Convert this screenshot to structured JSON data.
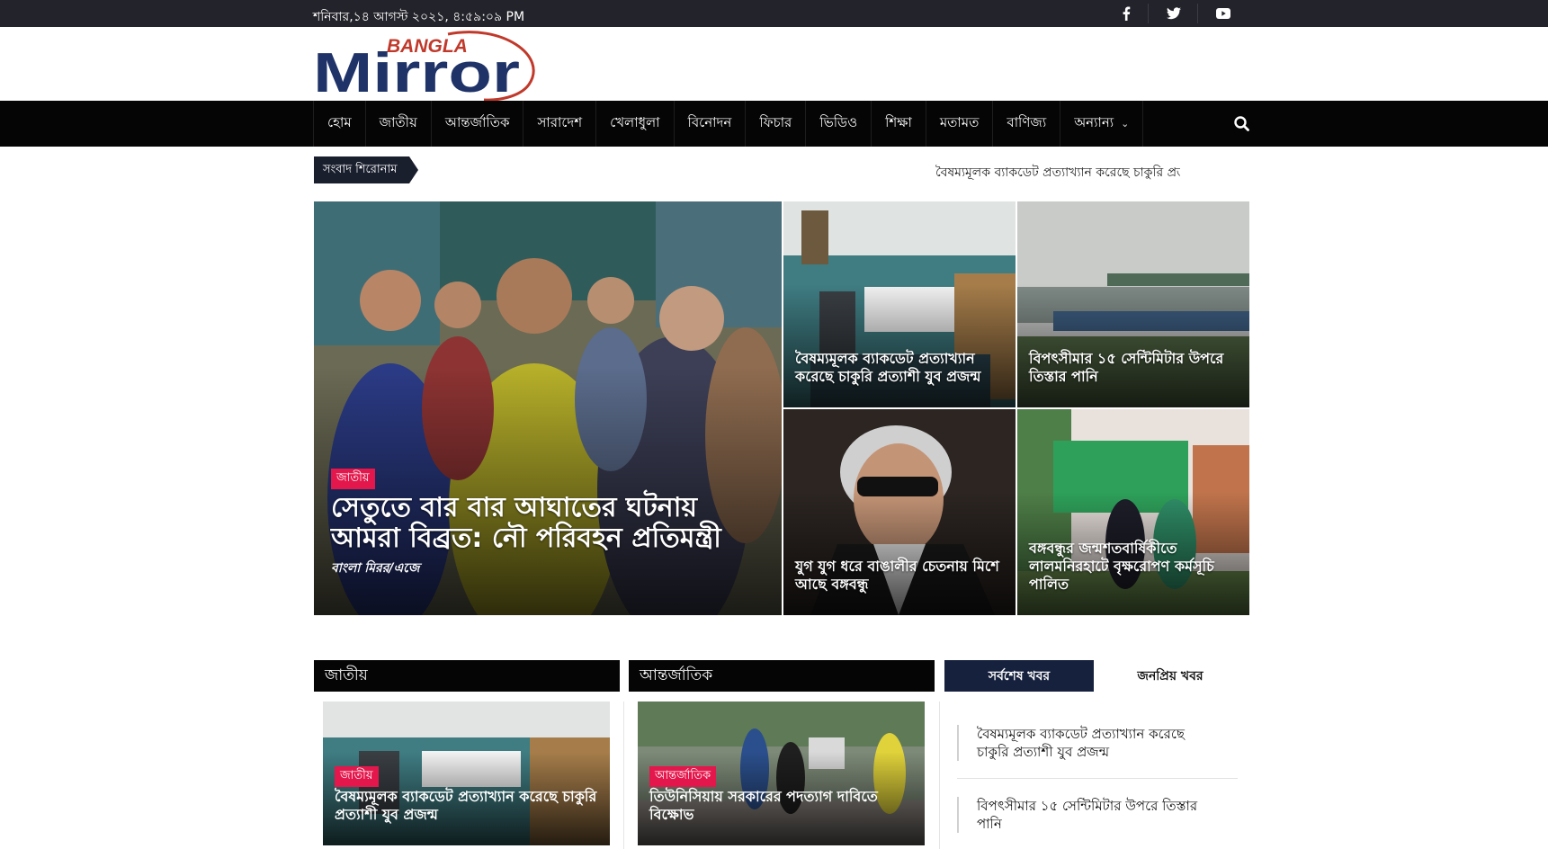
{
  "topbar": {
    "datetime": "শনিবার,১৪ আগস্ট ২০২১, ৪:৫৯:০৯ PM",
    "social_icons": [
      "facebook-icon",
      "twitter-icon",
      "youtube-icon"
    ]
  },
  "logo": {
    "small_text": "BANGLA",
    "big_text": "Mirror"
  },
  "nav": {
    "items": [
      "হোম",
      "জাতীয়",
      "আন্তর্জাতিক",
      "সারাদেশ",
      "খেলাধুলা",
      "বিনোদন",
      "ফিচার",
      "ভিডিও",
      "শিক্ষা",
      "মতামত",
      "বাণিজ্য",
      "অন্যান্য"
    ],
    "search_icon": "search-icon"
  },
  "ticker": {
    "label": "সংবাদ শিরোনাম",
    "text": "বৈষম্যমূলক ব্যাকডেট প্রত্যাখ্যান করেছে চাকুরি প্রত্যাশী যুব প্রজন্ম"
  },
  "feature": {
    "main": {
      "category": "জাতীয়",
      "title": "সেতুতে বার বার আঘাতের ঘটনায় আমরা বিব্রত: নৌ পরিবহন প্রতিমন্ত্রী",
      "byline": "বাংলা মিরর/এজে"
    },
    "tiles": [
      {
        "title": "বৈষম্যমূলক ব্যাকডেট প্রত্যাখ্যান করেছে চাকুরি প্রত্যাশী যুব প্রজন্ম"
      },
      {
        "title": "বিপৎসীমার ১৫ সেন্টিমিটার উপরে তিস্তার পানি"
      },
      {
        "title": "যুগ যুগ ধরে বাঙালীর চেতনায় মিশে আছে বঙ্গবন্ধু"
      },
      {
        "title": "বঙ্গবন্ধুর জন্মশতবার্ষিকীতে লালমনিরহাটে বৃক্ষরোপণ কর্মসূচি পালিত"
      }
    ]
  },
  "sections": {
    "national": {
      "heading": "জাতীয়",
      "card": {
        "category": "জাতীয়",
        "title": "বৈষম্যমূলক ব্যাকডেট প্রত্যাখ্যান করেছে চাকুরি প্রত্যাশী যুব প্রজন্ম"
      }
    },
    "international": {
      "heading": "আন্তর্জাতিক",
      "card": {
        "category": "আন্তর্জাতিক",
        "title": "তিউনিসিয়ায় সরকারের পদত্যাগ দাবিতে বিক্ষোভ"
      }
    },
    "tabs": {
      "latest": "সর্বশেষ খবর",
      "popular": "জনপ্রিয় খবর"
    },
    "latest_list": [
      "বৈষম্যমূলক ব্যাকডেট প্রত্যাখ্যান করেছে চাকুরি প্রত্যাশী যুব প্রজন্ম",
      "বিপৎসীমার ১৫ সেন্টিমিটার উপরে তিস্তার পানি"
    ]
  },
  "colors": {
    "topbar": "#23232b",
    "nav": "#050505",
    "badge": "#e3174b",
    "tab_active": "#16213e",
    "logo_navy": "#1f3368",
    "logo_red": "#c0392b"
  }
}
